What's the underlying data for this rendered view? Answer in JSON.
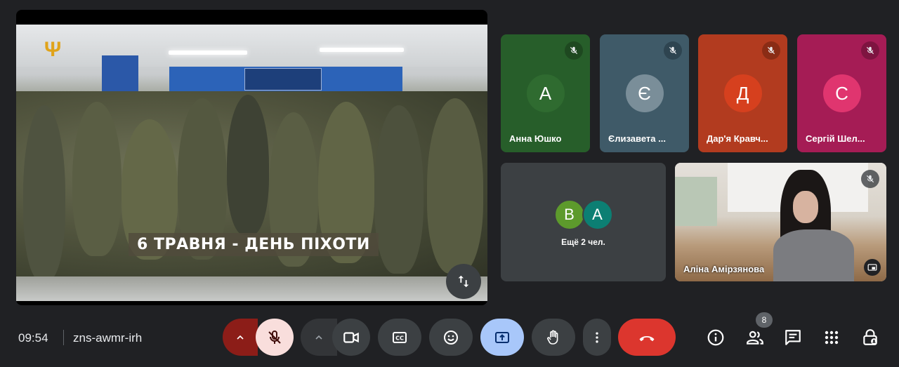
{
  "presentation": {
    "caption": "6 ТРАВНЯ - ДЕНЬ ПІХОТИ"
  },
  "participants": [
    {
      "initial": "А",
      "name": "Анна Юшко",
      "tile_color": "#275e2a",
      "avatar_color": "#2f6b30"
    },
    {
      "initial": "Є",
      "name": "Єлизавета ...",
      "tile_color": "#3f5a68",
      "avatar_color": "#7a8e99"
    },
    {
      "initial": "Д",
      "name": "Дар'я Кравч...",
      "tile_color": "#b23b1f",
      "avatar_color": "#d6401e"
    },
    {
      "initial": "С",
      "name": "Сергій Шел...",
      "tile_color": "#a51c55",
      "avatar_color": "#e0356f"
    }
  ],
  "group_tile": {
    "avatars": [
      {
        "initial": "В",
        "color": "#5d9a2c"
      },
      {
        "initial": "А",
        "color": "#0c7f73"
      }
    ],
    "label": "Ещё 2 чел."
  },
  "self_view": {
    "name": "Аліна Амірзянова"
  },
  "bottom_bar": {
    "time": "09:54",
    "meeting_code": "zns-awmr-irh",
    "people_count": "8"
  },
  "colors": {
    "background": "#202124",
    "control_bg": "#3c4043",
    "mic_off_red": "#f9dedc",
    "mic_off_dark": "#8c1d18",
    "present_blue": "#a8c7fa",
    "hangup_red": "#dc362e"
  }
}
